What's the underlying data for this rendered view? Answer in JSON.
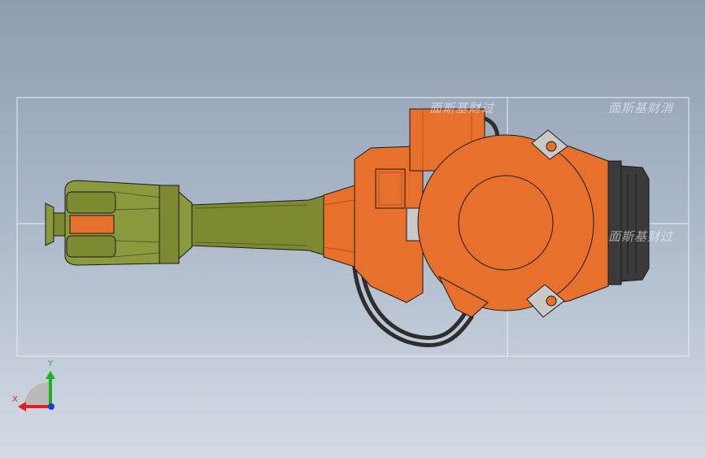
{
  "viewport": {
    "background": [
      "#8f9db0",
      "#d3dbe5"
    ],
    "watermarks": [
      "面斯基财过",
      "面斯基财消",
      "面斯基财过"
    ]
  },
  "model": {
    "name": "robot-arm-assembly",
    "colors": {
      "body": "#e8702d",
      "body_dark": "#b9531c",
      "arm": "#7d8a32",
      "arm_dark": "#55601f",
      "wrist": "#8c9a3f",
      "motor": "#3a3a3a",
      "cable": "#2e2e2e",
      "outline": "#1a1a1a"
    }
  },
  "triad": {
    "x_label": "X",
    "y_label": "Y",
    "x_color": "#e0201e",
    "y_color": "#1db320",
    "z_color": "#1a3cdd"
  }
}
